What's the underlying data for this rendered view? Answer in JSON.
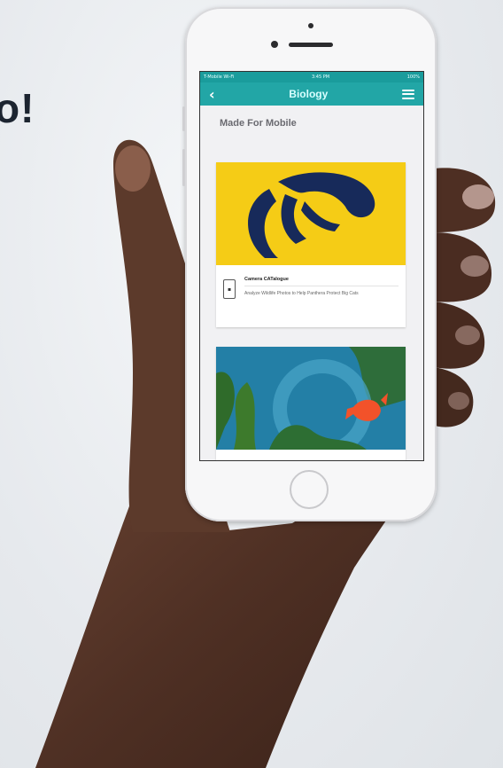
{
  "headline": "o!",
  "app": {
    "status_bar": {
      "carrier": "T-Mobile Wi-Fi",
      "time": "3:45 PM",
      "battery": "100%"
    },
    "nav": {
      "title": "Biology"
    },
    "section_title": "Made For Mobile",
    "cards": [
      {
        "title": "Camera CATalogue",
        "description": "Analyze Wildlife Photos to Help Panthera Protect Big Cats"
      },
      {
        "title": "",
        "description": ""
      }
    ]
  },
  "colors": {
    "nav": "#22a6a6",
    "card_banner": "#f5cc16",
    "logo": "#172a5a"
  },
  "icons": [
    "back-icon",
    "menu-icon",
    "home-button",
    "mobile-device-icon"
  ]
}
